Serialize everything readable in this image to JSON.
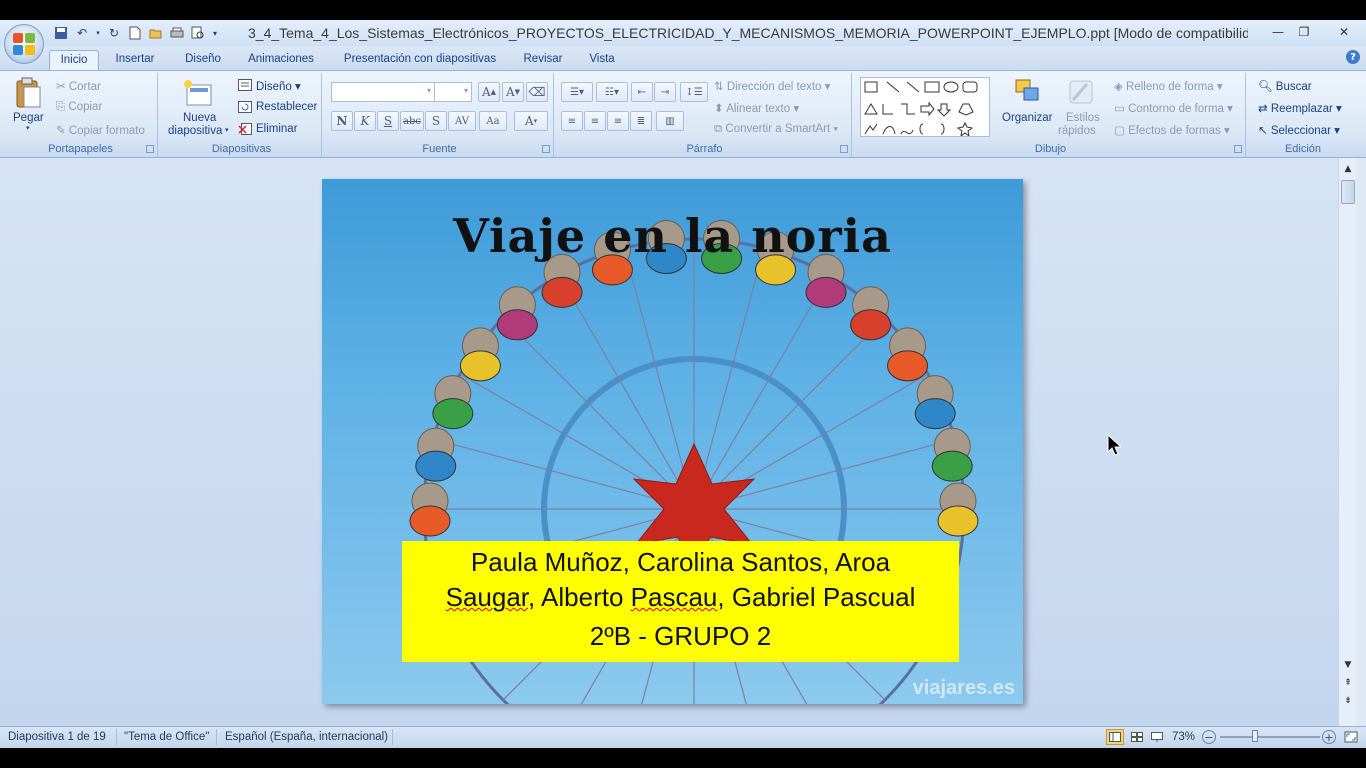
{
  "window": {
    "title": "3_4_Tema_4_Los_Sistemas_Electrónicos_PROYECTOS_ELECTRICIDAD_Y_MECANISMOS_MEMORIA_POWERPOINT_EJEMPLO.ppt [Modo de compatibilid..."
  },
  "tabs": [
    "Inicio",
    "Insertar",
    "Diseño",
    "Animaciones",
    "Presentación con diapositivas",
    "Revisar",
    "Vista"
  ],
  "ribbon": {
    "portapapeles": {
      "label": "Portapapeles",
      "pegar": "Pegar",
      "cortar": "Cortar",
      "copiar": "Copiar",
      "copiar_formato": "Copiar formato"
    },
    "diapositivas": {
      "label": "Diapositivas",
      "nueva_1": "Nueva",
      "nueva_2": "diapositiva",
      "diseno": "Diseño",
      "restablecer": "Restablecer",
      "eliminar": "Eliminar"
    },
    "fuente": {
      "label": "Fuente"
    },
    "parrafo": {
      "label": "Párrafo",
      "direccion": "Dirección del texto",
      "alinear": "Alinear texto",
      "convertir": "Convertir a SmartArt"
    },
    "dibujo": {
      "label": "Dibujo",
      "organizar": "Organizar",
      "estilos_1": "Estilos",
      "estilos_2": "rápidos",
      "relleno": "Relleno de forma",
      "contorno": "Contorno de forma",
      "efectos": "Efectos de formas"
    },
    "edicion": {
      "label": "Edición",
      "buscar": "Buscar",
      "reemplazar": "Reemplazar",
      "seleccionar": "Seleccionar"
    }
  },
  "slide": {
    "title": "Viaje en la noria",
    "names_line1": "Paula Muñoz, Carolina Santos, Aroa",
    "names_line2a": "Saugar",
    "names_line2b": ", Alberto ",
    "names_line2c": "Pascau",
    "names_line2d": ", Gabriel Pascual",
    "group_line": "2ºB - GRUPO 2",
    "watermark": "viajares.es"
  },
  "status": {
    "slide_info": "Diapositiva 1 de 19",
    "theme": "\"Tema de Office\"",
    "language": "Español (España, internacional)",
    "zoom": "73%"
  },
  "colors": {
    "caption_bg": "#ffff00",
    "sky": "#4aa3dd"
  }
}
